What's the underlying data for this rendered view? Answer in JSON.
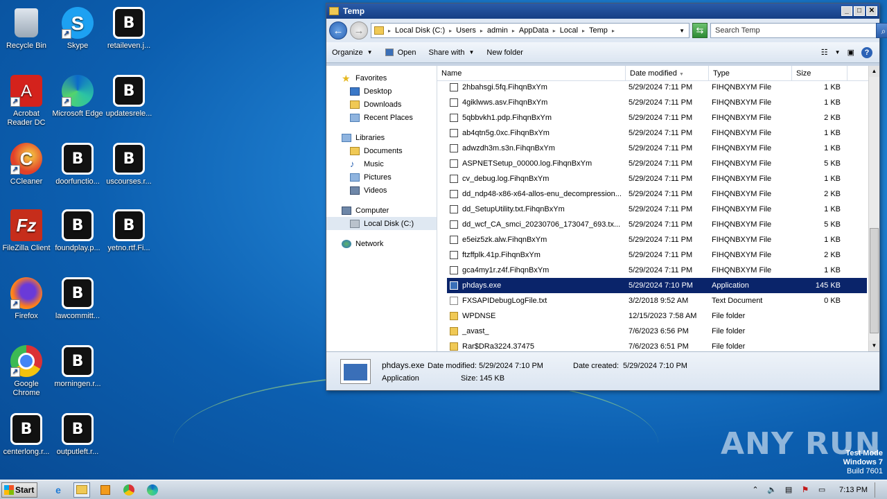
{
  "desktop": {
    "icons": [
      {
        "label": "Recycle Bin",
        "icon": "recycle-bin-icon"
      },
      {
        "label": "Skype",
        "icon": "skype-icon"
      },
      {
        "label": "retaileven.j...",
        "icon": "file-icon"
      },
      {
        "label": "Acrobat Reader DC",
        "icon": "acrobat-icon"
      },
      {
        "label": "Microsoft Edge",
        "icon": "edge-icon"
      },
      {
        "label": "updatesrele...",
        "icon": "file-icon"
      },
      {
        "label": "CCleaner",
        "icon": "ccleaner-icon"
      },
      {
        "label": "doorfunctio...",
        "icon": "file-icon"
      },
      {
        "label": "uscourses.r...",
        "icon": "file-icon"
      },
      {
        "label": "FileZilla Client",
        "icon": "filezilla-icon"
      },
      {
        "label": "foundplay.p...",
        "icon": "file-icon"
      },
      {
        "label": "yetno.rtf.Fi...",
        "icon": "file-icon"
      },
      {
        "label": "Firefox",
        "icon": "firefox-icon"
      },
      {
        "label": "lawcommitt...",
        "icon": "file-icon"
      },
      {
        "label": "Google Chrome",
        "icon": "chrome-icon"
      },
      {
        "label": "morningen.r...",
        "icon": "file-icon"
      },
      {
        "label": "centerlong.r...",
        "icon": "file-icon"
      },
      {
        "label": "outputleft.r...",
        "icon": "file-icon"
      }
    ],
    "watermark": "ANY RUN",
    "test_mode": {
      "line1": "Test Mode",
      "line2": "Windows 7",
      "line3": "Build 7601"
    }
  },
  "window": {
    "title": "Temp",
    "address": {
      "crumbs": [
        "Local Disk (C:)",
        "Users",
        "admin",
        "AppData",
        "Local",
        "Temp"
      ]
    },
    "search": {
      "placeholder": "Search Temp"
    },
    "commands": {
      "organize": "Organize",
      "open": "Open",
      "share_with": "Share with",
      "new_folder": "New folder"
    },
    "nav": {
      "favorites": "Favorites",
      "desktop": "Desktop",
      "downloads": "Downloads",
      "recent_places": "Recent Places",
      "libraries": "Libraries",
      "documents": "Documents",
      "music": "Music",
      "pictures": "Pictures",
      "videos": "Videos",
      "computer": "Computer",
      "local_disk": "Local Disk (C:)",
      "network": "Network"
    },
    "columns": {
      "name": "Name",
      "date": "Date modified",
      "type": "Type",
      "size": "Size"
    },
    "files": [
      {
        "name": "2hbahsgi.5fq.FihqnBxYm",
        "date": "5/29/2024 7:11 PM",
        "type": "FIHQNBXYM File",
        "size": "1 KB",
        "kind": "file"
      },
      {
        "name": "4giklwws.asv.FihqnBxYm",
        "date": "5/29/2024 7:11 PM",
        "type": "FIHQNBXYM File",
        "size": "1 KB",
        "kind": "file"
      },
      {
        "name": "5qbbvkh1.pdp.FihqnBxYm",
        "date": "5/29/2024 7:11 PM",
        "type": "FIHQNBXYM File",
        "size": "2 KB",
        "kind": "file"
      },
      {
        "name": "ab4qtn5g.0xc.FihqnBxYm",
        "date": "5/29/2024 7:11 PM",
        "type": "FIHQNBXYM File",
        "size": "1 KB",
        "kind": "file"
      },
      {
        "name": "adwzdh3m.s3n.FihqnBxYm",
        "date": "5/29/2024 7:11 PM",
        "type": "FIHQNBXYM File",
        "size": "1 KB",
        "kind": "file"
      },
      {
        "name": "ASPNETSetup_00000.log.FihqnBxYm",
        "date": "5/29/2024 7:11 PM",
        "type": "FIHQNBXYM File",
        "size": "5 KB",
        "kind": "file"
      },
      {
        "name": "cv_debug.log.FihqnBxYm",
        "date": "5/29/2024 7:11 PM",
        "type": "FIHQNBXYM File",
        "size": "1 KB",
        "kind": "file"
      },
      {
        "name": "dd_ndp48-x86-x64-allos-enu_decompression...",
        "date": "5/29/2024 7:11 PM",
        "type": "FIHQNBXYM File",
        "size": "2 KB",
        "kind": "file"
      },
      {
        "name": "dd_SetupUtility.txt.FihqnBxYm",
        "date": "5/29/2024 7:11 PM",
        "type": "FIHQNBXYM File",
        "size": "1 KB",
        "kind": "file"
      },
      {
        "name": "dd_wcf_CA_smci_20230706_173047_693.tx...",
        "date": "5/29/2024 7:11 PM",
        "type": "FIHQNBXYM File",
        "size": "5 KB",
        "kind": "file"
      },
      {
        "name": "e5eiz5zk.alw.FihqnBxYm",
        "date": "5/29/2024 7:11 PM",
        "type": "FIHQNBXYM File",
        "size": "1 KB",
        "kind": "file"
      },
      {
        "name": "ftzffplk.41p.FihqnBxYm",
        "date": "5/29/2024 7:11 PM",
        "type": "FIHQNBXYM File",
        "size": "2 KB",
        "kind": "file"
      },
      {
        "name": "gca4my1r.z4f.FihqnBxYm",
        "date": "5/29/2024 7:11 PM",
        "type": "FIHQNBXYM File",
        "size": "1 KB",
        "kind": "file"
      },
      {
        "name": "phdays.exe",
        "date": "5/29/2024 7:10 PM",
        "type": "Application",
        "size": "145 KB",
        "kind": "app",
        "selected": true
      },
      {
        "name": "FXSAPIDebugLogFile.txt",
        "date": "3/2/2018 9:52 AM",
        "type": "Text Document",
        "size": "0 KB",
        "kind": "txt"
      },
      {
        "name": "WPDNSE",
        "date": "12/15/2023 7:58 AM",
        "type": "File folder",
        "size": "",
        "kind": "folder"
      },
      {
        "name": "_avast_",
        "date": "7/6/2023 6:56 PM",
        "type": "File folder",
        "size": "",
        "kind": "folder"
      },
      {
        "name": "Rar$DRa3224.37475",
        "date": "7/6/2023 6:51 PM",
        "type": "File folder",
        "size": "",
        "kind": "folder"
      }
    ],
    "details": {
      "name": "phdays.exe",
      "modified_label": "Date modified:",
      "modified": "5/29/2024 7:10 PM",
      "created_label": "Date created:",
      "created": "5/29/2024 7:10 PM",
      "type": "Application",
      "size_label": "Size:",
      "size": "145 KB"
    }
  },
  "taskbar": {
    "start": "Start",
    "clock": "7:13 PM"
  }
}
